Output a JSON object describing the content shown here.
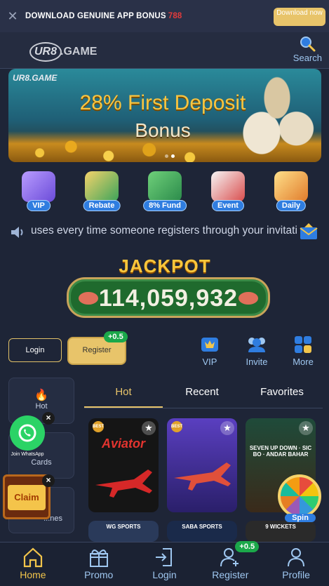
{
  "download_bar": {
    "text": "DOWNLOAD GENUINE APP BONUS",
    "bonus": "788",
    "button": "Download now",
    "close_glyph": "✕"
  },
  "header": {
    "logo_mark": "UR8",
    "logo_text": ".GAME",
    "search_label": "Search"
  },
  "banner": {
    "logo": "UR8.GAME",
    "title": "28% First Deposit",
    "subtitle": "Bonus"
  },
  "quick_links": [
    {
      "label": "VIP",
      "icon": "vip-icon",
      "color": "#8c6bf0"
    },
    {
      "label": "Rebate",
      "icon": "rebate-icon",
      "color": "#e0a62a"
    },
    {
      "label": "8% Fund",
      "icon": "fund-icon",
      "color": "#3cb95a"
    },
    {
      "label": "Event",
      "icon": "event-icon",
      "color": "#d94b4b"
    },
    {
      "label": "Daily",
      "icon": "daily-icon",
      "color": "#f0b43a"
    }
  ],
  "marquee": {
    "text": "uses every time someone registers through your invitatio"
  },
  "jackpot": {
    "title": "JACKPOT",
    "amount": "114,059,932"
  },
  "auth": {
    "login": "Login",
    "register": "Register",
    "register_bonus": "+0.5"
  },
  "actions": [
    {
      "label": "VIP",
      "icon": "crown-icon"
    },
    {
      "label": "Invite",
      "icon": "people-icon"
    },
    {
      "label": "More",
      "icon": "grid-icon"
    }
  ],
  "side_categories": [
    {
      "label": "Hot",
      "icon": "flame-icon"
    },
    {
      "label": "Cards",
      "icon": "cards-icon"
    },
    {
      "label": "...nes",
      "icon": "games-icon"
    }
  ],
  "tabs": [
    "Hot",
    "Recent",
    "Favorites"
  ],
  "games": [
    {
      "name": "Aviator",
      "bg": "#1a1a1a",
      "accent": "#e3342f"
    },
    {
      "name": "",
      "bg": "#3a2f8a",
      "accent": "#e3342f"
    },
    {
      "name": "SEVEN UP DOWN · SIC BO · ANDAR BAHAR",
      "bg": "#1f4b3a",
      "accent": "#f4c44a"
    },
    {
      "name": "WG SPORTS",
      "bg": "#2a3a5a",
      "accent": "#fff"
    },
    {
      "name": "SABA SPORTS",
      "bg": "#1a2a4a",
      "accent": "#fff"
    },
    {
      "name": "9 WICKETS",
      "bg": "#2a2a2a",
      "accent": "#fff"
    }
  ],
  "widgets": {
    "whatsapp_label": "Join WhatsApp",
    "claim": "Claim",
    "spin": "Spin"
  },
  "bottom_nav": [
    {
      "label": "Home",
      "icon": "home-icon",
      "active": true
    },
    {
      "label": "Promo",
      "icon": "gift-icon",
      "active": false
    },
    {
      "label": "Login",
      "icon": "login-icon",
      "active": false
    },
    {
      "label": "Register",
      "icon": "add-user-icon",
      "active": false,
      "badge": "+0.5"
    },
    {
      "label": "Profile",
      "icon": "user-icon",
      "active": false
    }
  ],
  "colors": {
    "background": "#1e2537",
    "accent_gold": "#e8c46a",
    "link_blue": "#9fc7f0",
    "bonus_green": "#1ba84a"
  }
}
